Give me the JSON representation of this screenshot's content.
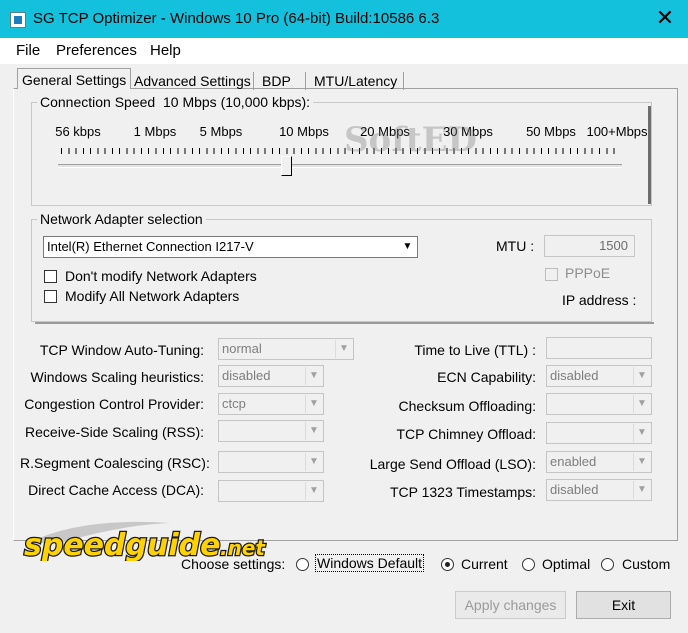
{
  "window": {
    "title": "SG TCP Optimizer - Windows 10 Pro (64-bit) Build:10586 6.3",
    "close_glyph": "✕"
  },
  "menu": [
    "File",
    "Preferences",
    "Help"
  ],
  "tabs": [
    "General Settings",
    "Advanced Settings",
    "BDP",
    "MTU/Latency"
  ],
  "connection_speed": {
    "legend": "Connection Speed",
    "value_label": "10 Mbps (10,000 kbps):",
    "marks": [
      "56 kbps",
      "1 Mbps",
      "5 Mbps",
      "10 Mbps",
      "20 Mbps",
      "30 Mbps",
      "50 Mbps",
      "100+Mbps"
    ],
    "selected_index": 3
  },
  "adapter": {
    "legend": "Network Adapter selection",
    "selected": "Intel(R) Ethernet Connection I217-V",
    "mtu_label": "MTU :",
    "mtu_value": "1500",
    "pppoe_label": "PPPoE",
    "ip_label": "IP address :",
    "dont_modify_label": "Don't modify Network Adapters",
    "modify_all_label": "Modify All Network Adapters"
  },
  "settings_left": [
    {
      "label": "TCP Window Auto-Tuning:",
      "value": "normal"
    },
    {
      "label": "Windows Scaling heuristics:",
      "value": "disabled"
    },
    {
      "label": "Congestion Control Provider:",
      "value": "ctcp"
    },
    {
      "label": "Receive-Side Scaling (RSS):",
      "value": ""
    },
    {
      "label": "R.Segment Coalescing (RSC):",
      "value": ""
    },
    {
      "label": "Direct Cache Access (DCA):",
      "value": ""
    }
  ],
  "settings_right": [
    {
      "label": "Time to Live (TTL) :",
      "value": ""
    },
    {
      "label": "ECN Capability:",
      "value": "disabled"
    },
    {
      "label": "Checksum Offloading:",
      "value": ""
    },
    {
      "label": "TCP Chimney Offload:",
      "value": ""
    },
    {
      "label": "Large Send Offload (LSO):",
      "value": "enabled"
    },
    {
      "label": "TCP 1323 Timestamps:",
      "value": "disabled"
    }
  ],
  "choose": {
    "label": "Choose settings:",
    "options": [
      "Windows Default",
      "Current",
      "Optimal",
      "Custom"
    ],
    "selected": "Current"
  },
  "buttons": {
    "apply": "Apply changes",
    "exit": "Exit"
  },
  "logo": {
    "text": "speedguide",
    "suffix": ".net"
  },
  "watermark": {
    "text": "SoftED"
  },
  "icons": {
    "dropdown": "▼"
  },
  "colors": {
    "titlebar": "#14c1dd",
    "logo_text": "#ffd200",
    "logo_outline": "#1a1a1a"
  }
}
